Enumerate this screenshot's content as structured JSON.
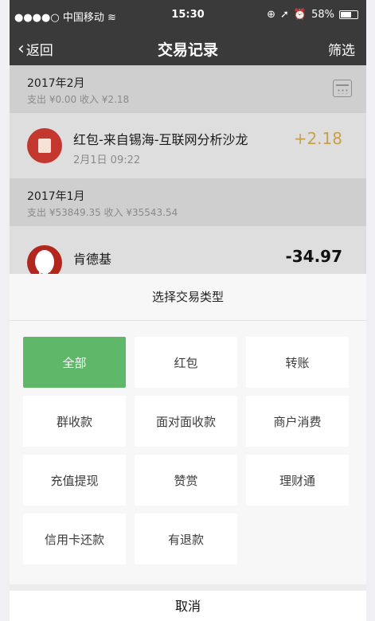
{
  "status_bar": {
    "carrier": "●●●●○ 中国移动 ",
    "time": "15:30",
    "battery": "58%",
    "battery_level": 0.58
  },
  "nav": {
    "back_label": "返回",
    "title": "交易记录",
    "filter_label": "筛选"
  },
  "sections": [
    {
      "month": "2017年2月",
      "summary": "支出 ¥0.00 收入 ¥2.18",
      "items": [
        {
          "title": "红包-来自锡海-互联网分析沙龙",
          "date": "2月1日 09:22",
          "amount": "+2.18",
          "amount_color": "#c9a04a"
        }
      ]
    },
    {
      "month": "2017年1月",
      "summary": "支出 ¥53849.35 收入 ¥35543.54",
      "items": [
        {
          "title": "肯德基",
          "date": "",
          "amount": "-34.97",
          "amount_color": "#111111"
        }
      ]
    }
  ],
  "sheet": {
    "title": "选择交易类型",
    "options": [
      "全部",
      "红包",
      "转账",
      "群收款",
      "面对面收款",
      "商户消费",
      "充值提现",
      "赞赏",
      "理财通",
      "信用卡还款",
      "有退款"
    ],
    "selected": "全部",
    "accent_color": "#5fb86a",
    "cancel_label": "取消"
  },
  "icons": {
    "kfc_text": "KFC"
  }
}
